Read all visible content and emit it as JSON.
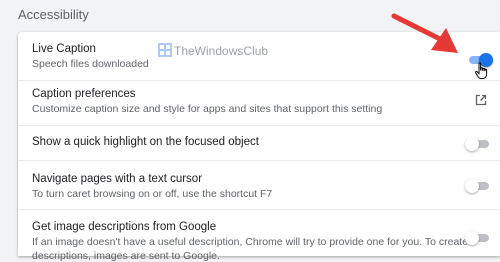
{
  "section": {
    "title": "Accessibility"
  },
  "settings": [
    {
      "title": "Live Caption",
      "description": "Speech files downloaded",
      "control": "toggle",
      "enabled": true
    },
    {
      "title": "Caption preferences",
      "description": "Customize caption size and style for apps and sites that support this setting",
      "control": "external-link-icon"
    },
    {
      "title": "Show a quick highlight on the focused object",
      "control": "toggle",
      "enabled": false
    },
    {
      "title": "Navigate pages with a text cursor",
      "description": "To turn caret browsing on or off, use the shortcut F7",
      "control": "toggle",
      "enabled": false
    },
    {
      "title": "Get image descriptions from Google",
      "description_line1": "If an image doesn't have a useful description, Chrome will try to provide one for you. To create",
      "description_line2": "descriptions, images are sent to Google.",
      "control": "toggle",
      "enabled": false
    }
  ],
  "watermark": {
    "text": "TheWindowsClub"
  },
  "colors": {
    "accent": "#1a73e8",
    "arrow": "#e53935",
    "background": "#f1f3f4"
  }
}
